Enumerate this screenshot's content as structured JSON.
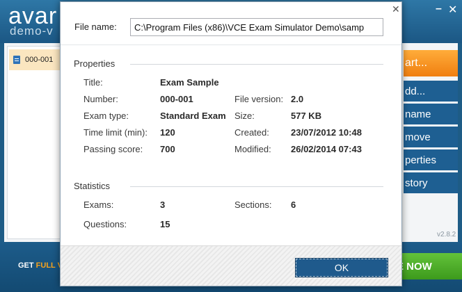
{
  "app": {
    "logo_main": "avar",
    "logo_sub": "demo-v",
    "minimize_glyph": "–",
    "close_glyph": "✕",
    "exam_list": [
      {
        "label": "000-001"
      }
    ],
    "buttons": {
      "start": "art...",
      "add": "dd...",
      "rename": "name",
      "remove": "move",
      "properties": "perties",
      "history": "story"
    },
    "version": "v2.8.2",
    "footer": {
      "promo_prefix": "GET ",
      "promo_highlight": "FULL V",
      "buy_label": "E NOW"
    },
    "colors": {
      "accent_orange": "#f7931e",
      "brand_blue": "#1e5c86",
      "buy_green": "#4caf26"
    }
  },
  "dialog": {
    "close_glyph": "✕",
    "file_name_label": "File name:",
    "file_name_value": "C:\\Program Files (x86)\\VCE Exam Simulator Demo\\samp",
    "properties": {
      "title": "Properties",
      "title_label": "Title:",
      "title_value": "Exam Sample",
      "number_label": "Number:",
      "number_value": "000-001",
      "exam_type_label": "Exam type:",
      "exam_type_value": "Standard Exam",
      "time_limit_label": "Time limit (min):",
      "time_limit_value": "120",
      "passing_score_label": "Passing score:",
      "passing_score_value": "700",
      "file_version_label": "File version:",
      "file_version_value": "2.0",
      "size_label": "Size:",
      "size_value": "577 KB",
      "created_label": "Created:",
      "created_value": "23/07/2012 10:48",
      "modified_label": "Modified:",
      "modified_value": "26/02/2014 07:43"
    },
    "statistics": {
      "title": "Statistics",
      "exams_label": "Exams:",
      "exams_value": "3",
      "sections_label": "Sections:",
      "sections_value": "6",
      "questions_label": "Questions:",
      "questions_value": "15"
    },
    "ok_label": "OK"
  }
}
